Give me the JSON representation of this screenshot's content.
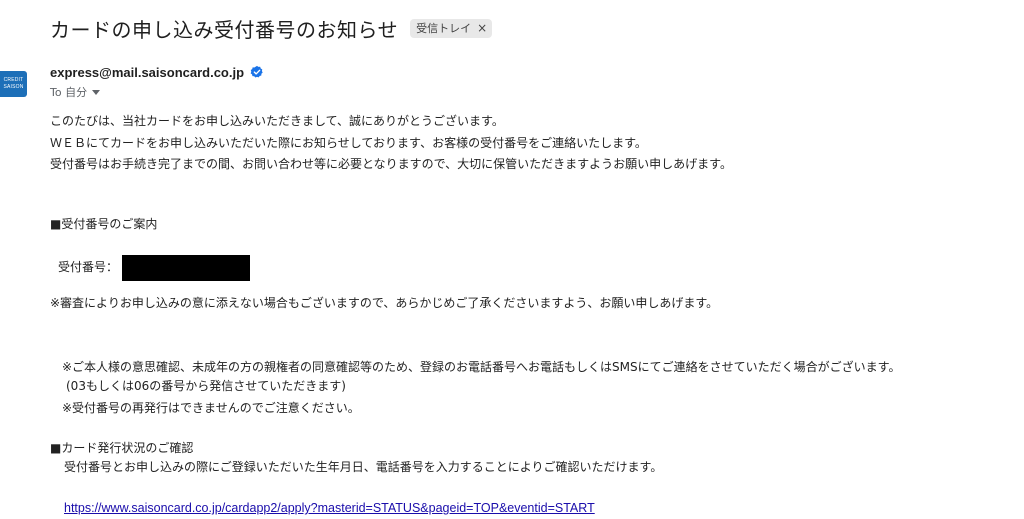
{
  "email": {
    "subject": "カードの申し込み受付番号のお知らせ",
    "label_chip": "受信トレイ",
    "label_chip_close": "×",
    "sender_email": "express@mail.saisoncard.co.jp",
    "avatar": {
      "line1": "CREDIT",
      "line2": "SAISON"
    },
    "recipient": "To 自分",
    "verified_icon": "verified-badge-icon",
    "body": {
      "p1": "このたびは、当社カードをお申し込みいただきまして、誠にありがとうございます。",
      "p2": "ＷＥＢにてカードをお申し込みいただいた際にお知らせしております、お客様の受付番号をご連絡いたします。",
      "p3": "受付番号はお手続き完了までの間、お問い合わせ等に必要となりますので、大切に保管いただきますようお願い申しあげます。",
      "h1": "■受付番号のご案内",
      "receipt_label": "受付番号：",
      "note1": "※審査によりお申し込みの意に添えない場合もございますので、あらかじめご了承くださいますよう、お願い申しあげます。",
      "note2": "※ご本人様の意思確認、未成年の方の親権者の同意確認等のため、登録のお電話番号へお電話もしくはSMSにてご連絡をさせていただく場合がございます。",
      "note3": "(03もしくは06の番号から発信させていただきます)",
      "note4": "※受付番号の再発行はできませんのでご注意ください。",
      "h2": "■カード発行状況のご確認",
      "p4": "受付番号とお申し込みの際にご登録いただいた生年月日、電話番号を入力することによりご確認いただけます。",
      "link": "https://www.saisoncard.co.jp/cardapp2/apply?masterid=STATUS&pageid=TOP&eventid=START"
    }
  },
  "colors": {
    "link": "#1a0dab",
    "verified": "#1a73e8",
    "avatar_bg": "#1d6fb8",
    "chip_bg": "#e8e8e8"
  }
}
